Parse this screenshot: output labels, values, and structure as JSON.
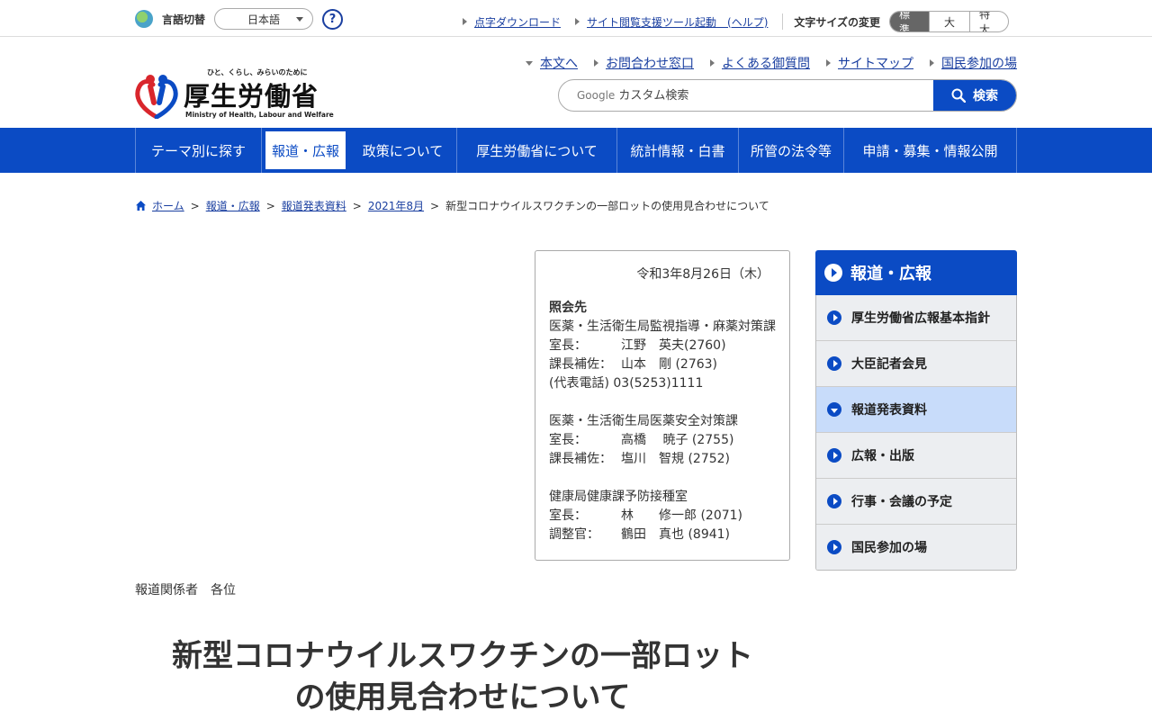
{
  "utility": {
    "lang_label": "言語切替",
    "lang_value": "日本語",
    "help_label": "?",
    "links": [
      {
        "label": "点字ダウンロード"
      },
      {
        "label": "サイト閲覧支援ツール起動　(ヘルプ)"
      }
    ],
    "fontsize_label": "文字サイズの変更",
    "fontsizes": [
      "標準",
      "大",
      "特大"
    ]
  },
  "header": {
    "logo_tagline": "ひと、くらし、みらいのために",
    "logo_name": "厚生労働省",
    "logo_english": "Ministry of Health, Labour and Welfare",
    "links": [
      "本文へ",
      "お問合わせ窓口",
      "よくある御質問",
      "サイトマップ",
      "国民参加の場"
    ],
    "search_placeholder": "カスタム検索",
    "search_brand": "Google",
    "search_button": "検索"
  },
  "gnav": [
    {
      "label": "テーマ別に探す"
    },
    {
      "label": "報道・広報"
    },
    {
      "label": "政策について"
    },
    {
      "label": "厚生労働省について"
    },
    {
      "label": "統計情報・白書"
    },
    {
      "label": "所管の法令等"
    },
    {
      "label": "申請・募集・情報公開"
    }
  ],
  "breadcrumb": {
    "items": [
      "ホーム",
      "報道・広報",
      "報道発表資料",
      "2021年8月"
    ],
    "separator": ">",
    "current": "新型コロナウイルスワクチンの一部ロットの使用見合わせについて"
  },
  "contact": {
    "date": "令和3年8月26日（木）",
    "heading": "照会先",
    "groups": [
      {
        "dept": "医薬・生活衛生局監視指導・麻薬対策課",
        "rows": [
          {
            "k": "室長：",
            "v": "江野　英夫(2760)"
          },
          {
            "k": "課長補佐：",
            "v": "山本　剛 (2763)"
          }
        ],
        "extra": "(代表電話) 03(5253)1111"
      },
      {
        "dept": "医薬・生活衛生局医薬安全対策課",
        "rows": [
          {
            "k": "室長：",
            "v": "高橋　 暁子 (2755)"
          },
          {
            "k": "課長補佐：",
            "v": "塩川　智規 (2752)"
          }
        ]
      },
      {
        "dept": "健康局健康課予防接種室",
        "rows": [
          {
            "k": "室長：",
            "v": "林　　修一郎 (2071)"
          },
          {
            "k": "調整官：",
            "v": "鶴田　真也 (8941)"
          }
        ]
      }
    ]
  },
  "addressee": "報道関係者　各位",
  "title_line1": "新型コロナウイルスワクチンの一部ロット",
  "title_line2": "の使用見合わせについて",
  "side": {
    "heading": "報道・広報",
    "items": [
      {
        "label": "厚生労働省広報基本指針",
        "active": false
      },
      {
        "label": "大臣記者会見",
        "active": false
      },
      {
        "label": "報道発表資料",
        "active": true
      },
      {
        "label": "広報・出版",
        "active": false
      },
      {
        "label": "行事・会議の予定",
        "active": false
      },
      {
        "label": "国民参加の場",
        "active": false
      }
    ]
  },
  "colors": {
    "brand_blue": "#0b4bc4",
    "link_blue": "#1a3fa0",
    "side_active": "#c8dcfa"
  }
}
